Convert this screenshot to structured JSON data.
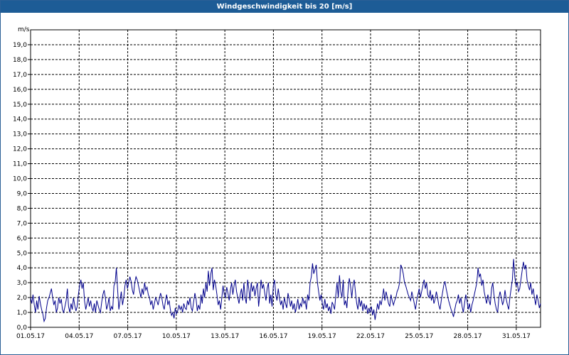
{
  "window": {
    "title": "Windgeschwindigkeit bis 20 [m/s]"
  },
  "colors": {
    "titlebar": "#1d5c96",
    "series": "#00008b",
    "grid": "#000000"
  },
  "chart_data": {
    "type": "line",
    "title": "Windgeschwindigkeit bis 20 [m/s]",
    "ylabel": "m/s",
    "xlabel": "",
    "ylim": [
      0,
      20
    ],
    "xlim": [
      "2017-05-01",
      "2017-06-01T12:00"
    ],
    "grid": true,
    "legend": "none",
    "y_ticks": [
      "0,0",
      "1,0",
      "2,0",
      "3,0",
      "4,0",
      "5,0",
      "6,0",
      "7,0",
      "8,0",
      "9,0",
      "10,0",
      "11,0",
      "12,0",
      "13,0",
      "14,0",
      "15,0",
      "16,0",
      "17,0",
      "18,0",
      "19,0"
    ],
    "x_ticks": [
      "01.05.17",
      "04.05.17",
      "07.05.17",
      "10.05.17",
      "13.05.17",
      "16.05.17",
      "19.05.17",
      "22.05.17",
      "25.05.17",
      "28.05.17",
      "31.05.17"
    ],
    "series": [
      {
        "values": [
          2.0,
          1.6,
          2.2,
          1.5,
          1.0,
          1.8,
          1.2,
          2.1,
          1.6,
          1.2,
          0.9,
          0.4,
          0.6,
          1.3,
          1.8,
          2.0,
          2.3,
          2.6,
          2.0,
          1.5,
          1.8,
          1.0,
          1.3,
          2.0,
          1.6,
          1.9,
          1.2,
          1.0,
          1.4,
          1.8,
          2.6,
          1.4,
          1.0,
          1.6,
          1.2,
          2.0,
          1.5,
          1.1,
          1.4,
          2.2,
          2.8,
          3.2,
          2.6,
          3.0,
          1.8,
          1.2,
          1.6,
          2.0,
          1.4,
          1.8,
          1.3,
          1.1,
          1.6,
          1.0,
          1.8,
          1.5,
          1.2,
          1.0,
          1.7,
          2.2,
          2.5,
          2.0,
          1.2,
          1.5,
          2.0,
          1.1,
          1.4,
          1.2,
          2.8,
          3.0,
          4.0,
          2.5,
          1.2,
          1.8,
          2.4,
          1.5,
          2.0,
          2.8,
          3.2,
          2.6,
          3.0,
          3.4,
          3.1,
          2.5,
          2.2,
          3.0,
          3.4,
          3.2,
          2.8,
          2.4,
          2.0,
          2.6,
          2.2,
          3.0,
          2.5,
          2.7,
          2.2,
          2.0,
          1.5,
          1.8,
          1.2,
          1.6,
          2.0,
          1.8,
          1.5,
          1.9,
          2.3,
          2.0,
          1.5,
          1.2,
          1.8,
          2.2,
          1.5,
          1.8,
          1.2,
          0.8,
          1.0,
          0.6,
          1.3,
          0.9,
          1.1,
          1.5,
          1.2,
          1.4,
          1.0,
          1.6,
          1.3,
          1.2,
          1.8,
          1.5,
          2.0,
          1.3,
          1.1,
          1.7,
          2.3,
          1.9,
          1.1,
          1.5,
          1.2,
          2.2,
          1.6,
          2.6,
          2.0,
          3.0,
          2.4,
          3.8,
          2.8,
          3.6,
          4.0,
          2.5,
          3.2,
          2.8,
          2.2,
          1.5,
          1.8,
          1.2,
          2.0,
          2.8,
          2.2,
          2.0,
          2.7,
          2.3,
          1.8,
          2.5,
          3.0,
          2.2,
          2.8,
          3.2,
          2.4,
          2.0,
          1.6,
          2.2,
          2.6,
          1.8,
          3.0,
          2.0,
          1.6,
          3.2,
          2.6,
          1.8,
          3.0,
          2.4,
          2.8,
          2.1,
          2.6,
          3.0,
          1.4,
          2.2,
          3.2,
          2.6,
          2.9,
          2.3,
          1.8,
          2.6,
          3.0,
          1.6,
          2.2,
          1.4,
          2.8,
          3.2,
          2.2,
          1.8,
          2.6,
          2.0,
          1.5,
          1.8,
          1.2,
          2.0,
          1.6,
          1.3,
          2.3,
          1.9,
          1.4,
          1.8,
          1.2,
          1.6,
          1.0,
          1.4,
          1.9,
          1.2,
          1.6,
          1.4,
          2.0,
          1.6,
          1.8,
          1.2,
          2.2,
          1.8,
          3.0,
          3.4,
          4.3,
          3.6,
          3.9,
          4.2,
          3.0,
          2.4,
          1.8,
          2.2,
          1.6,
          1.2,
          1.9,
          1.3,
          1.6,
          1.1,
          1.4,
          0.9,
          1.7,
          1.5,
          1.2,
          2.2,
          3.0,
          2.0,
          3.5,
          2.4,
          2.0,
          3.2,
          1.5,
          1.8,
          1.3,
          2.5,
          3.3,
          2.8,
          2.0,
          2.8,
          3.2,
          2.4,
          1.6,
          1.2,
          2.0,
          1.4,
          1.8,
          1.1,
          1.6,
          1.2,
          1.5,
          0.9,
          1.3,
          1.0,
          1.4,
          0.8,
          1.2,
          0.5,
          1.0,
          1.6,
          1.2,
          1.8,
          1.5,
          2.0,
          2.6,
          1.8,
          2.4,
          2.0,
          1.6,
          1.4,
          2.2,
          1.8,
          1.5,
          1.8,
          2.0,
          2.4,
          2.6,
          3.0,
          4.2,
          4.0,
          3.6,
          3.0,
          2.8,
          2.5,
          2.2,
          2.0,
          1.8,
          2.4,
          2.0,
          1.6,
          1.2,
          1.8,
          2.2,
          2.6,
          2.0,
          2.4,
          2.8,
          3.2,
          2.6,
          3.0,
          2.2,
          2.0,
          2.5,
          1.8,
          2.2,
          1.6,
          1.9,
          2.4,
          2.0,
          1.5,
          1.2,
          1.8,
          2.3,
          2.8,
          3.1,
          2.6,
          2.2,
          1.8,
          1.5,
          1.2,
          1.0,
          0.7,
          1.2,
          1.6,
          1.8,
          2.2,
          1.6,
          2.0,
          1.4,
          1.0,
          1.6,
          2.2,
          1.8,
          1.2,
          1.6,
          1.0,
          1.5,
          1.8,
          2.2,
          2.6,
          3.0,
          4.0,
          3.4,
          3.6,
          2.8,
          3.2,
          2.4,
          2.0,
          1.6,
          2.2,
          1.8,
          1.5,
          2.6,
          3.0,
          2.2,
          1.6,
          1.2,
          1.0,
          2.0,
          2.4,
          2.0,
          1.5,
          1.8,
          2.5,
          1.9,
          1.5,
          1.2,
          2.0,
          2.6,
          3.2,
          4.6,
          3.4,
          2.8,
          3.0,
          2.4,
          2.6,
          3.2,
          3.8,
          4.4,
          3.9,
          4.2,
          3.2,
          2.8,
          2.5,
          3.0,
          2.2,
          2.6,
          2.0,
          1.5,
          2.2,
          1.8,
          1.3,
          1.6
        ]
      }
    ]
  }
}
